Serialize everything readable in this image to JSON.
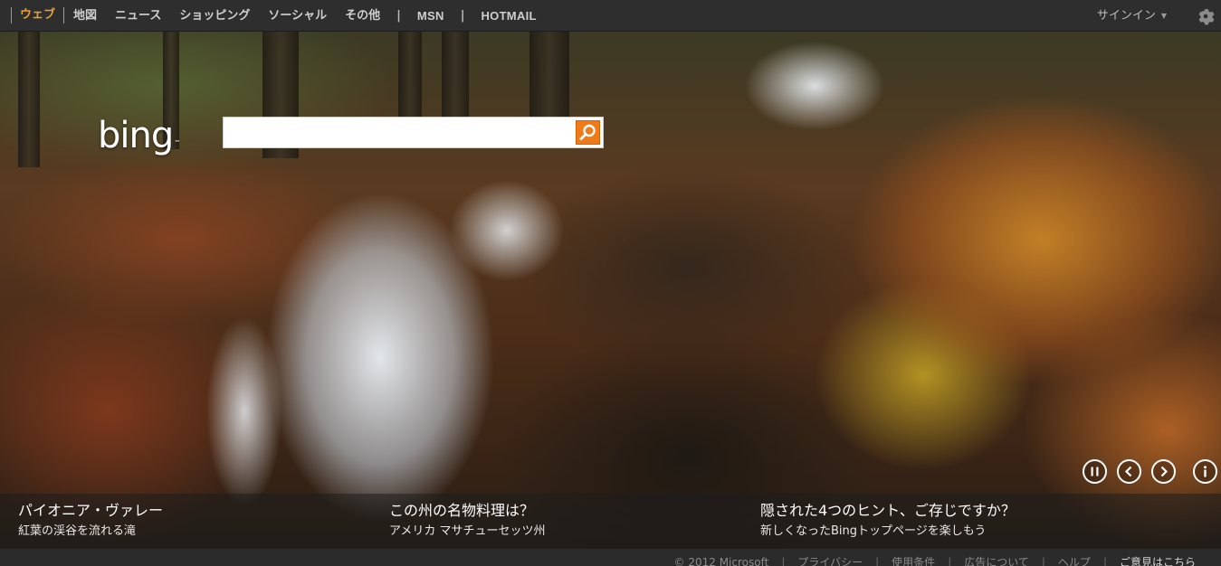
{
  "nav": {
    "items": [
      {
        "label": "ウェブ",
        "active": true
      },
      {
        "label": "地図"
      },
      {
        "label": "ニュース"
      },
      {
        "label": "ショッピング"
      },
      {
        "label": "ソーシャル"
      },
      {
        "label": "その他"
      }
    ],
    "separator": "|",
    "msn": "MSN",
    "hotmail": "HOTMAIL",
    "signin": "サインイン",
    "caret": "▼"
  },
  "logo": {
    "text": "bing",
    "tm": "™"
  },
  "search": {
    "value": "",
    "placeholder": ""
  },
  "controls": {
    "pause": "pause-icon",
    "prev": "chevron-left-icon",
    "next": "chevron-right-icon",
    "info": "info-icon"
  },
  "hotspots": [
    {
      "title": "パイオニア・ヴァレー",
      "subtitle": "紅葉の渓谷を流れる滝"
    },
    {
      "title": "この州の名物料理は？",
      "subtitle": "アメリカ マサチューセッツ州"
    },
    {
      "title": "隠された4つのヒント、ご存じですか？",
      "subtitle": "新しくなったBingトップページを楽しもう"
    }
  ],
  "footer": {
    "copyright": "© 2012 Microsoft",
    "privacy": "プライバシー",
    "terms": "使用条件",
    "ads": "広告について",
    "help": "ヘルプ",
    "feedback": "ご意見はこちら",
    "separator": "|"
  },
  "colors": {
    "accent": "#f0a22a",
    "search_button": "#f07a18",
    "topbar": "#2e2e2e"
  }
}
